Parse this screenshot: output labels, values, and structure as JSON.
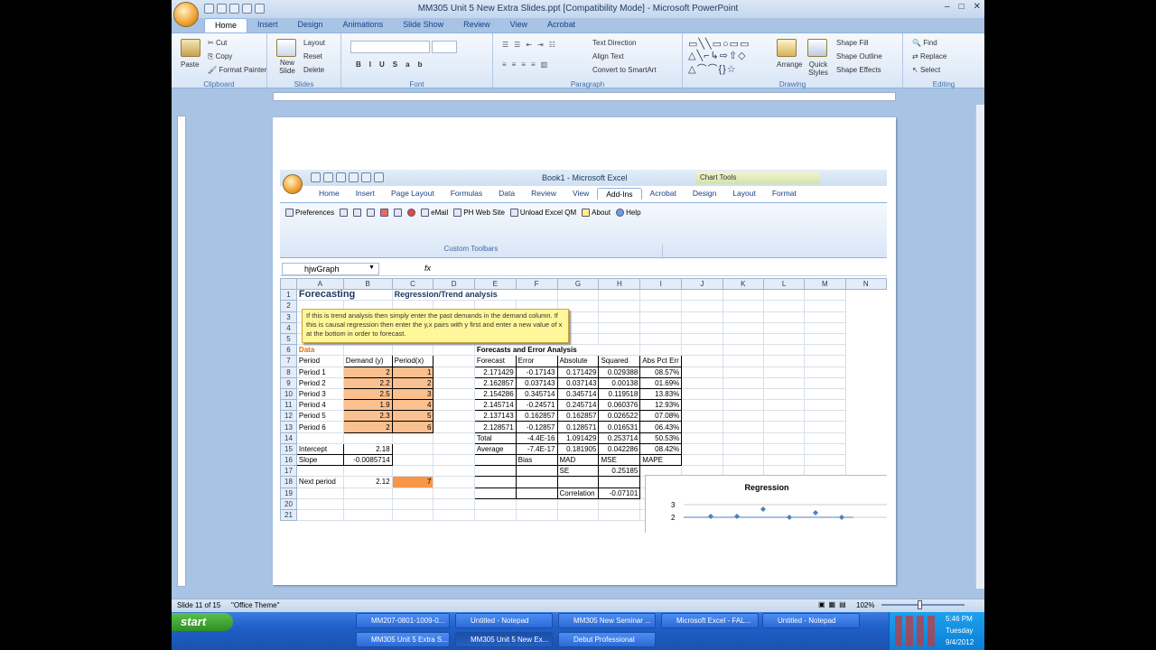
{
  "ppt": {
    "title": "MM305 Unit 5 New Extra Slides.ppt [Compatibility Mode] - Microsoft PowerPoint",
    "tabs": [
      "Home",
      "Insert",
      "Design",
      "Animations",
      "Slide Show",
      "Review",
      "View",
      "Acrobat"
    ],
    "clipboard": {
      "paste": "Paste",
      "cut": "Cut",
      "copy": "Copy",
      "format_painter": "Format Painter",
      "label": "Clipboard"
    },
    "slides": {
      "new_slide": "New Slide",
      "layout": "Layout",
      "reset": "Reset",
      "delete": "Delete",
      "label": "Slides"
    },
    "font": {
      "label": "Font"
    },
    "paragraph": {
      "text_direction": "Text Direction",
      "align_text": "Align Text",
      "smartart": "Convert to SmartArt",
      "label": "Paragraph"
    },
    "drawing": {
      "arrange": "Arrange",
      "quick_styles": "Quick Styles",
      "shape_fill": "Shape Fill",
      "shape_outline": "Shape Outline",
      "shape_effects": "Shape Effects",
      "label": "Drawing"
    },
    "editing": {
      "find": "Find",
      "replace": "Replace",
      "select": "Select",
      "label": "Editing"
    },
    "status": {
      "slide": "Slide 11 of 15",
      "theme": "\"Office Theme\"",
      "zoom": "102%"
    }
  },
  "excel": {
    "title": "Book1 - Microsoft Excel",
    "chart_tools": "Chart Tools",
    "tabs": [
      "Home",
      "Insert",
      "Page Layout",
      "Formulas",
      "Data",
      "Review",
      "View",
      "Add-Ins",
      "Acrobat",
      "Design",
      "Layout",
      "Format"
    ],
    "toolbar": {
      "preferences": "Preferences",
      "email": "eMail",
      "ph_web": "PH Web Site",
      "unload": "Unload Excel QM",
      "about": "About",
      "help": "Help",
      "group_label": "Custom Toolbars"
    },
    "namebox": "hjwGraph",
    "fx": "fx",
    "columns": [
      "A",
      "B",
      "C",
      "D",
      "E",
      "F",
      "G",
      "H",
      "I",
      "J",
      "K",
      "L",
      "M",
      "N"
    ],
    "tip": "If this is trend analysis then simply enter the past demands in the demand column. If this is causal regression then enter the y,x pairs with y first and enter a new value of x at the bottom in order to forecast.",
    "heading": "Forecasting",
    "subheading": "Regression/Trend analysis",
    "data_label": "Data",
    "period_hdr": "Period",
    "demand_hdr": "Demand (y)",
    "periodx_hdr": "Period(x)",
    "periods": [
      {
        "name": "Period 1",
        "y": "2",
        "x": "1"
      },
      {
        "name": "Period 2",
        "y": "2.2",
        "x": "2"
      },
      {
        "name": "Period 3",
        "y": "2.5",
        "x": "3"
      },
      {
        "name": "Period 4",
        "y": "1.9",
        "x": "4"
      },
      {
        "name": "Period 5",
        "y": "2.3",
        "x": "5"
      },
      {
        "name": "Period 6",
        "y": "2",
        "x": "6"
      }
    ],
    "intercept_label": "Intercept",
    "intercept": "2.18",
    "slope_label": "Slope",
    "slope": "-0.0085714",
    "next_label": "Next period",
    "next_value": "2.12",
    "next_x": "7",
    "fea_title": "Forecasts and Error Analysis",
    "fea_headers": [
      "Forecast",
      "Error",
      "Absolute",
      "Squared",
      "Abs Pct Err"
    ],
    "fea_rows": [
      [
        "2.171429",
        "-0.17143",
        "0.171429",
        "0.029388",
        "08.57%"
      ],
      [
        "2.162857",
        "0.037143",
        "0.037143",
        "0.00138",
        "01.69%"
      ],
      [
        "2.154286",
        "0.345714",
        "0.345714",
        "0.119518",
        "13.83%"
      ],
      [
        "2.145714",
        "-0.24571",
        "0.245714",
        "0.060376",
        "12.93%"
      ],
      [
        "2.137143",
        "0.162857",
        "0.162857",
        "0.026522",
        "07.08%"
      ],
      [
        "2.128571",
        "-0.12857",
        "0.128571",
        "0.016531",
        "06.43%"
      ]
    ],
    "total": [
      "Total",
      "-4.4E-16",
      "1.091429",
      "0.253714",
      "50.53%"
    ],
    "average": [
      "Average",
      "-7.4E-17",
      "0.181905",
      "0.042286",
      "08.42%"
    ],
    "sub": [
      "Bias",
      "MAD",
      "MSE",
      "MAPE"
    ],
    "se_label": "SE",
    "se": "0.25185",
    "corr_label": "Correlation",
    "corr": "-0.07101",
    "chart_title": "Regression",
    "chart_ticks": [
      "3",
      "2"
    ]
  },
  "taskbar": {
    "start": "start",
    "row1": [
      "MM207-0801-1009-0...",
      "Untitled - Notepad",
      "MM305 New Seminar ...",
      "Microsoft Excel - FAL...",
      "Untitled - Notepad"
    ],
    "row2": [
      "MM305 Unit 5 Extra S...",
      "MM305 Unit 5 New Ex...",
      "Debut Professional"
    ],
    "time": "5:46 PM",
    "day": "Tuesday",
    "date": "9/4/2012"
  }
}
